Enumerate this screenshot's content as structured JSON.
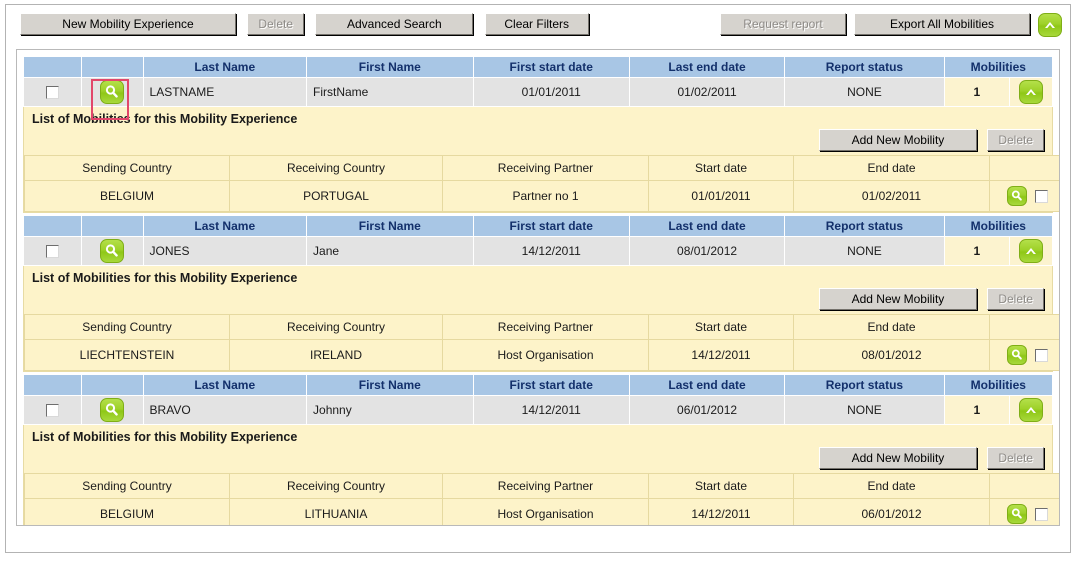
{
  "toolbar": {
    "new_mobility_experience": "New Mobility Experience",
    "delete": "Delete",
    "advanced_search": "Advanced Search",
    "clear_filters": "Clear Filters",
    "request_report": "Request report",
    "export_all_mobilities": "Export All Mobilities",
    "collapse_icon": "chevron-up-icon"
  },
  "master_columns": {
    "select": "",
    "view": "",
    "last_name": "Last Name",
    "first_name": "First Name",
    "first_start_date": "First start date",
    "last_end_date": "Last end date",
    "report_status": "Report status",
    "mobilities": "Mobilities"
  },
  "detail_columns": {
    "sending_country": "Sending Country",
    "receiving_country": "Receiving Country",
    "receiving_partner": "Receiving Partner",
    "start_date": "Start date",
    "end_date": "End date",
    "actions": ""
  },
  "detail_section": {
    "title": "List of Mobilities for this Mobility Experience",
    "add_new_mobility": "Add New Mobility",
    "delete": "Delete"
  },
  "icons": {
    "search": "magnifier-icon",
    "collapse": "chevron-up-icon",
    "checkbox": "checkbox-unchecked-icon"
  },
  "colors": {
    "header_blue": "#a8c6e5",
    "header_text": "#13306b",
    "row_gray": "#e3e3e3",
    "detail_yellow": "#fdf3c9",
    "accent_green": "#9ed129",
    "highlight_red": "#e2476a",
    "toolbar_gray": "#d6d3ce"
  },
  "rows": [
    {
      "last_name": "LASTNAME",
      "first_name": "FirstName",
      "first_start_date": "01/01/2011",
      "last_end_date": "01/02/2011",
      "report_status": "NONE",
      "mobilities": "1",
      "mobility": {
        "sending_country": "BELGIUM",
        "receiving_country": "PORTUGAL",
        "receiving_partner": "Partner no 1",
        "start_date": "01/01/2011",
        "end_date": "01/02/2011"
      }
    },
    {
      "last_name": "JONES",
      "first_name": "Jane",
      "first_start_date": "14/12/2011",
      "last_end_date": "08/01/2012",
      "report_status": "NONE",
      "mobilities": "1",
      "mobility": {
        "sending_country": "LIECHTENSTEIN",
        "receiving_country": "IRELAND",
        "receiving_partner": "Host Organisation",
        "start_date": "14/12/2011",
        "end_date": "08/01/2012"
      }
    },
    {
      "last_name": "BRAVO",
      "first_name": "Johnny",
      "first_start_date": "14/12/2011",
      "last_end_date": "06/01/2012",
      "report_status": "NONE",
      "mobilities": "1",
      "mobility": {
        "sending_country": "BELGIUM",
        "receiving_country": "LITHUANIA",
        "receiving_partner": "Host Organisation",
        "start_date": "14/12/2011",
        "end_date": "06/01/2012"
      }
    }
  ]
}
